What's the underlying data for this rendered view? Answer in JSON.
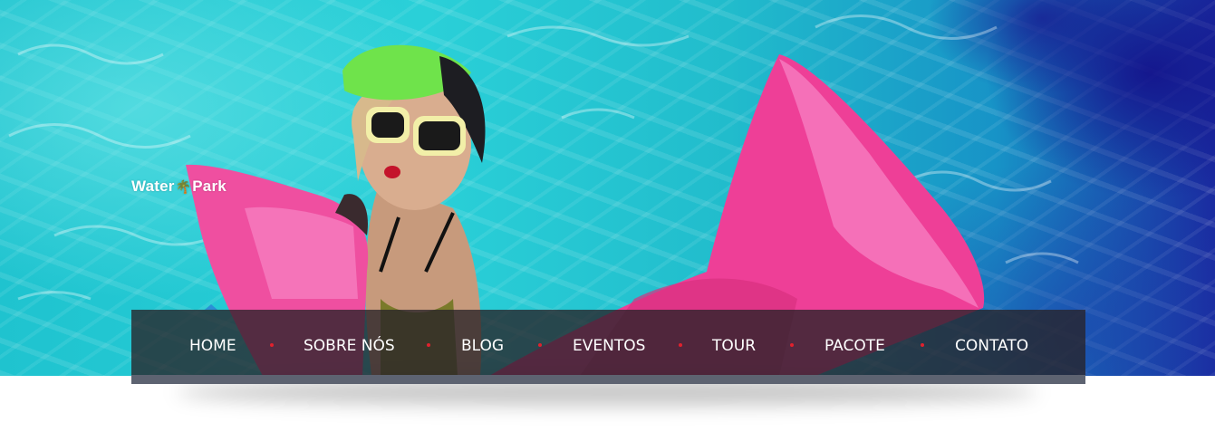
{
  "brand": {
    "logo_text_left": "Water",
    "logo_text_right": "Park"
  },
  "nav": {
    "items": [
      {
        "label": "HOME",
        "active": true
      },
      {
        "label": "SOBRE NÓS",
        "active": false
      },
      {
        "label": "BLOG",
        "active": false
      },
      {
        "label": "EVENTOS",
        "active": false
      },
      {
        "label": "TOUR",
        "active": false
      },
      {
        "label": "PACOTE",
        "active": false
      },
      {
        "label": "CONTATO",
        "active": false
      }
    ],
    "separator_color": "#e0212d",
    "active_indicator_color": "#2b8fd6"
  },
  "hero": {
    "image_name": "pool-woman-inflatable-hero"
  },
  "colors": {
    "nav_bg": "#2a2329",
    "nav_base": "#5d6371",
    "pool": "#22c6d2"
  }
}
